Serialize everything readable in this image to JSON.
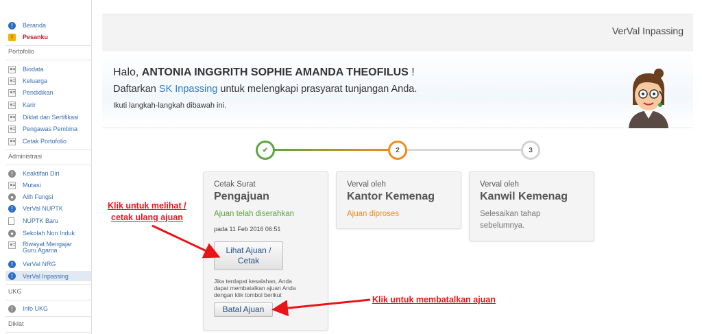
{
  "sidebar": {
    "top_items": [
      {
        "label": "Beranda",
        "icon": "info-icon"
      },
      {
        "label": "Pesanku",
        "icon": "message-icon"
      }
    ],
    "sections": [
      {
        "title": "Portofolio",
        "items": [
          "Biodata",
          "Keluarga",
          "Pendidikan",
          "Karir",
          "Diklat dan Sertifikasi",
          "Pengawas Pembina",
          "Cetak Portofolio"
        ]
      },
      {
        "title": "Administrasi",
        "items": [
          "Keaktifan Diri",
          "Mutasi",
          "Alih Fungsi",
          "VerVal NUPTK",
          "NUPTK Baru",
          "Sekolah Non Induk",
          "Riwayat Mengajar Guru Agama",
          "VerVal NRG",
          "VerVal Inpassing"
        ]
      },
      {
        "title": "UKG",
        "items": [
          "Info UKG"
        ]
      },
      {
        "title": "Diklat",
        "items": []
      }
    ]
  },
  "header": {
    "title": "VerVal Inpassing"
  },
  "welcome": {
    "greeting": "Halo, ",
    "name": "ANTONIA INGGRITH SOPHIE AMANDA THEOFILUS",
    "exclaim": " !",
    "daftar_prefix": "Daftarkan ",
    "daftar_link": "SK Inpassing",
    "daftar_suffix": " untuk melengkapi prasyarat tunjangan Anda.",
    "instruction": "Ikuti langkah-langkah dibawah ini."
  },
  "steps": [
    {
      "marker": "✔",
      "color": "#5aa53f"
    },
    {
      "marker": "2",
      "color": "#f08a1c"
    },
    {
      "marker": "3",
      "color": "#cfcfcf"
    }
  ],
  "cards": [
    {
      "top": "Cetak Surat",
      "title": "Pengajuan",
      "status": "Ajuan telah diserahkan",
      "status_color": "#5aa53f",
      "date": "pada 11 Feb 2016 06:51",
      "view_button_line1": "Lihat Ajuan /",
      "view_button_line2": "Cetak",
      "cancel_note": "Jika terdapat kesalahan, Anda dapat membatalkan ajuan Anda dengan klik tombol berikut",
      "cancel_button": "Batal Ajuan"
    },
    {
      "top": "Verval oleh",
      "title": "Kantor Kemenag",
      "status": "Ajuan diproses",
      "status_color": "#f08a1c"
    },
    {
      "top": "Verval oleh",
      "title": "Kanwil Kemenag",
      "status_line1": "Selesaikan tahap",
      "status_line2": "sebelumnya.",
      "status_color": "#777777"
    }
  ],
  "annotations": {
    "view_line1": "Klik untuk melihat /",
    "view_line2": "cetak ulang ajuan",
    "cancel": "Klik untuk membatalkan ajuan"
  }
}
